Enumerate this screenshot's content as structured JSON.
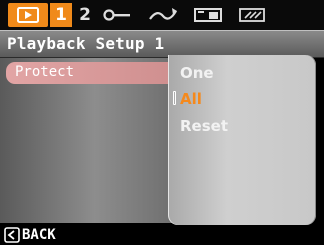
{
  "tabs": {
    "items": [
      {
        "name": "playback-icon",
        "active": true
      },
      {
        "label": "1",
        "active": true
      },
      {
        "label": "2",
        "active": false
      },
      {
        "name": "wrench-icon"
      },
      {
        "name": "curve-icon"
      },
      {
        "name": "memory-card-icon"
      },
      {
        "name": "internal-memory-icon"
      }
    ],
    "tab1_label": "1",
    "tab2_label": "2"
  },
  "title": "Playback Setup 1",
  "menu": {
    "selected_item": "Protect"
  },
  "submenu": {
    "options": [
      "One",
      "All",
      "Reset"
    ],
    "selected": "All"
  },
  "footer": {
    "back_label": "BACK",
    "back_icon": "chevron-left-icon"
  },
  "colors": {
    "accent": "#f08a1a",
    "selection_text": "#f5891c",
    "highlight": "#d89a9a"
  }
}
